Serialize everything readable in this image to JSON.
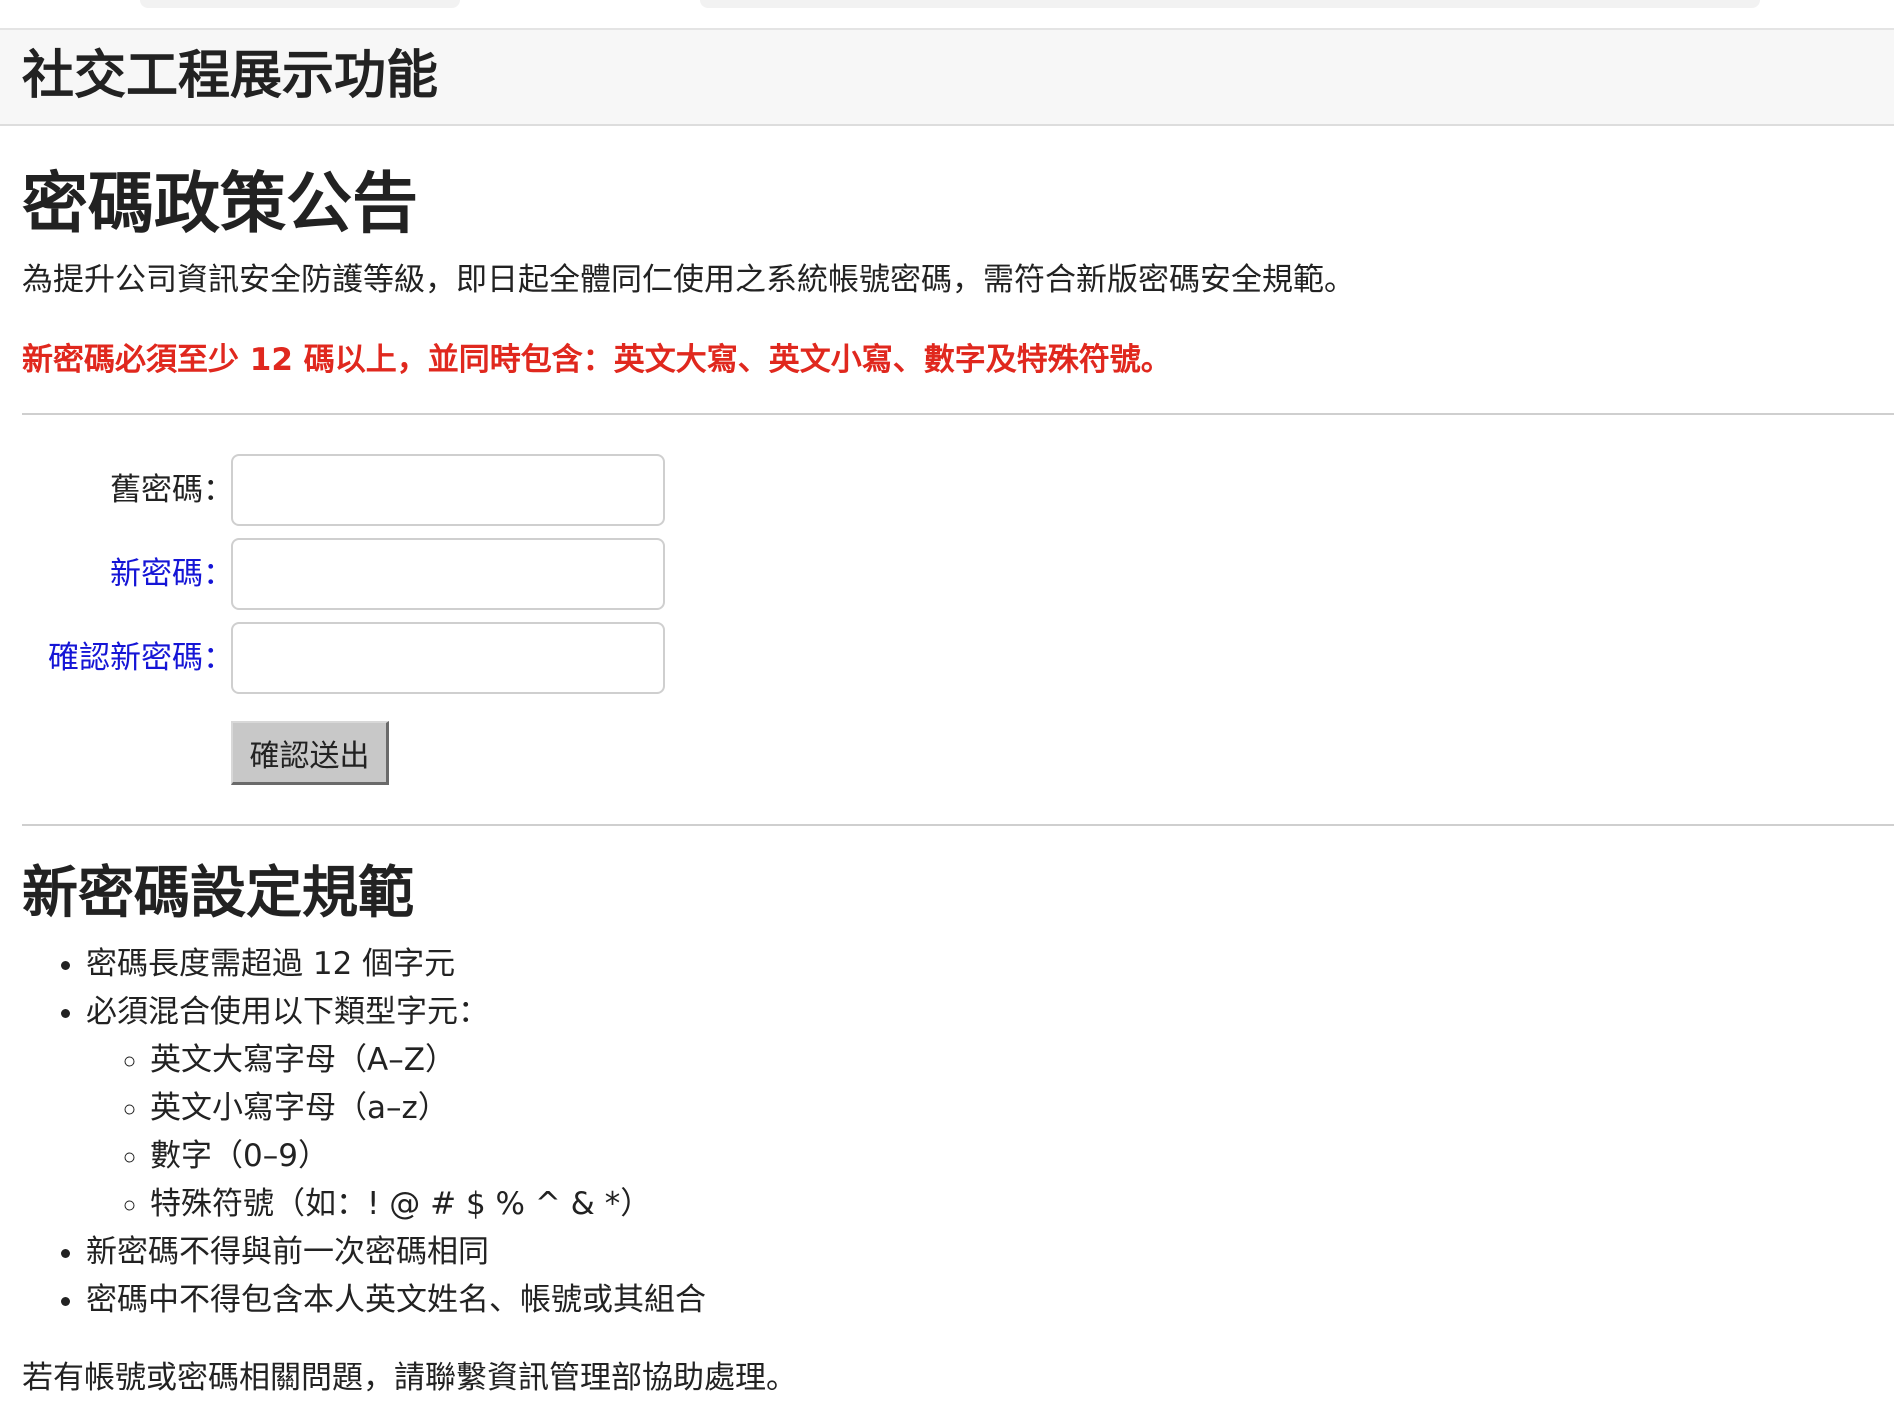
{
  "header": {
    "site_title": "社交工程展示功能"
  },
  "main": {
    "heading": "密碼政策公告",
    "intro": "為提升公司資訊安全防護等級，即日起全體同仁使用之系統帳號密碼，需符合新版密碼安全規範。",
    "warning": "新密碼必須至少 12 碼以上，並同時包含：英文大寫、英文小寫、數字及特殊符號。"
  },
  "form": {
    "old_password_label": "舊密碼：",
    "new_password_label": "新密碼：",
    "confirm_password_label": "確認新密碼：",
    "old_password_value": "",
    "new_password_value": "",
    "confirm_password_value": "",
    "submit_label": "確認送出",
    "label_color_default": "#222222",
    "label_color_highlight": "#1515d6"
  },
  "rules": {
    "heading": "新密碼設定規範",
    "items": [
      "密碼長度需超過 12 個字元",
      "必須混合使用以下類型字元：",
      "新密碼不得與前一次密碼相同",
      "密碼中不得包含本人英文姓名、帳號或其組合"
    ],
    "sub_items": [
      "英文大寫字母（A–Z）",
      "英文小寫字母（a–z）",
      "數字（0–9）",
      "特殊符號（如：! @ # $ % ^ & *）"
    ]
  },
  "footer": {
    "note": "若有帳號或密碼相關問題，請聯繫資訊管理部協助處理。"
  },
  "colors": {
    "warning": "#e0281e",
    "header_bg": "#f7f7f7",
    "button_bg": "#c8c8c8"
  }
}
